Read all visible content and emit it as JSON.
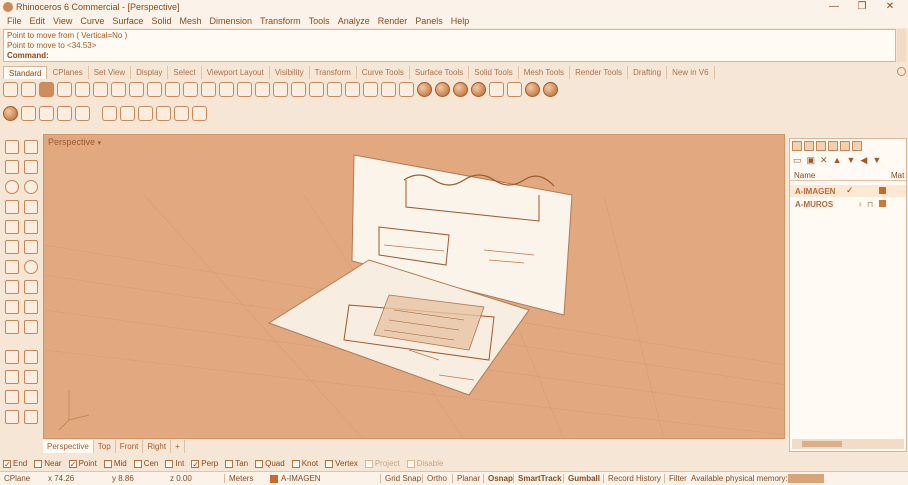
{
  "window": {
    "title": "Rhinoceros 6 Commercial - [Perspective]",
    "minimize_icon": "minimize-icon",
    "maximize_icon": "maximize-icon",
    "close_icon": "close-icon"
  },
  "menu": [
    "File",
    "Edit",
    "View",
    "Curve",
    "Surface",
    "Solid",
    "Mesh",
    "Dimension",
    "Transform",
    "Tools",
    "Analyze",
    "Render",
    "Panels",
    "Help"
  ],
  "command": {
    "history_1": "Point to move from ( Vertical=No )",
    "history_2": "Point to move to <34.53>",
    "prompt": "Command:",
    "value": ""
  },
  "toolbar_tabs": [
    "Standard",
    "CPlanes",
    "Set View",
    "Display",
    "Select",
    "Viewport Layout",
    "Visibility",
    "Transform",
    "Curve Tools",
    "Surface Tools",
    "Solid Tools",
    "Mesh Tools",
    "Render Tools",
    "Drafting",
    "New in V6"
  ],
  "active_tab": "Standard",
  "viewport": {
    "label": "Perspective",
    "dropdown_icon": "chevron-down-icon"
  },
  "viewport_tabs": [
    "Perspective",
    "Top",
    "Front",
    "Right"
  ],
  "add_viewport_icon": "plus-icon",
  "layers": {
    "columns": {
      "name": "Name",
      "material": "Mat"
    },
    "rows": [
      {
        "name": "A-IMAGEN",
        "current": "✓",
        "color": "#c86a2a"
      },
      {
        "name": "A-MUROS",
        "current": "",
        "color": "#c87a3a"
      }
    ]
  },
  "osnaps": [
    {
      "label": "End",
      "checked": true
    },
    {
      "label": "Near",
      "checked": false
    },
    {
      "label": "Point",
      "checked": true
    },
    {
      "label": "Mid",
      "checked": false
    },
    {
      "label": "Cen",
      "checked": false
    },
    {
      "label": "Int",
      "checked": false
    },
    {
      "label": "Perp",
      "checked": true
    },
    {
      "label": "Tan",
      "checked": false
    },
    {
      "label": "Quad",
      "checked": false
    },
    {
      "label": "Knot",
      "checked": false
    },
    {
      "label": "Vertex",
      "checked": false
    },
    {
      "label": "Project",
      "checked": false,
      "disabled": true
    },
    {
      "label": "Disable",
      "checked": false,
      "disabled": true
    }
  ],
  "status": {
    "cplane": "CPlane",
    "x": "x 74.26",
    "y": "y 8.86",
    "z": "z 0.00",
    "units": "Meters",
    "layer": "A-IMAGEN",
    "grid_snap": "Grid Snap",
    "ortho": "Ortho",
    "planar": "Planar",
    "osnap": "Osnap",
    "smarttrack": "SmartTrack",
    "gumball": "Gumball",
    "record_history": "Record History",
    "filter": "Filter",
    "memory": "Available physical memory:"
  }
}
